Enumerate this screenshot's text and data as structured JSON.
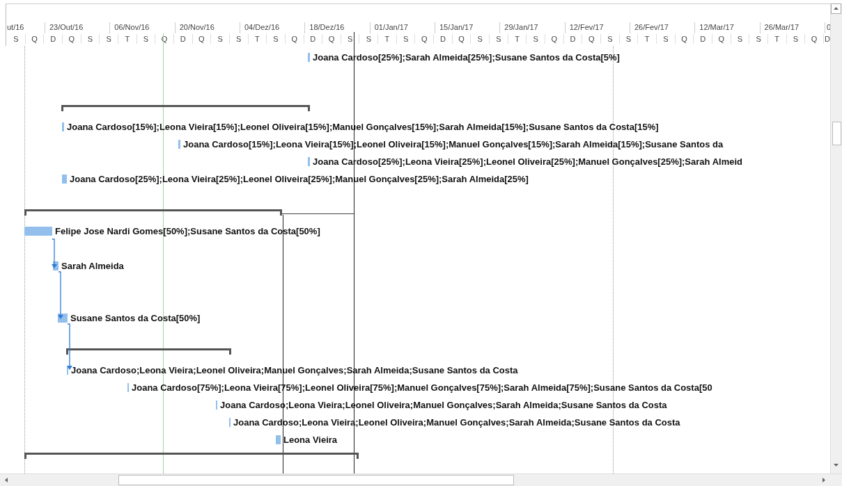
{
  "timescale": {
    "major": [
      "ut/16",
      "23/Out/16",
      "06/Nov/16",
      "20/Nov/16",
      "04/Dez/16",
      "18/Dez/16",
      "01/Jan/17",
      "15/Jan/17",
      "29/Jan/17",
      "12/Fev/17",
      "26/Fev/17",
      "12/Mar/17",
      "26/Mar/17",
      "0"
    ],
    "minor": [
      "S",
      "Q",
      "D",
      "Q",
      "S",
      "S",
      "T",
      "S",
      "Q",
      "D",
      "Q",
      "S",
      "S",
      "T",
      "S",
      "Q",
      "D",
      "Q",
      "S",
      "S",
      "T",
      "S",
      "Q",
      "D",
      "Q",
      "S",
      "S",
      "T",
      "S",
      "Q",
      "D",
      "Q",
      "S",
      "S",
      "T",
      "S",
      "Q",
      "D",
      "Q",
      "S",
      "S",
      "T",
      "S",
      "Q",
      "D"
    ]
  },
  "rows": [
    {
      "kind": "task",
      "label": "Joana Cardoso[25%];Sarah Almeida[25%];Susane Santos da Costa[5%]"
    },
    {
      "kind": "summary"
    },
    {
      "kind": "task",
      "label": "Joana Cardoso[15%];Leona Vieira[15%];Leonel Oliveira[15%];Manuel Gonçalves[15%];Sarah Almeida[15%];Susane Santos da Costa[15%]"
    },
    {
      "kind": "task",
      "label": "Joana Cardoso[15%];Leona Vieira[15%];Leonel Oliveira[15%];Manuel Gonçalves[15%];Sarah Almeida[15%];Susane Santos da"
    },
    {
      "kind": "task",
      "label": "Joana Cardoso[25%];Leona Vieira[25%];Leonel Oliveira[25%];Manuel Gonçalves[25%];Sarah Almeid"
    },
    {
      "kind": "task",
      "label": "Joana Cardoso[25%];Leona Vieira[25%];Leonel Oliveira[25%];Manuel Gonçalves[25%];Sarah Almeida[25%]"
    },
    {
      "kind": "summary"
    },
    {
      "kind": "task",
      "label": "Felipe Jose Nardi Gomes[50%];Susane Santos da Costa[50%]"
    },
    {
      "kind": "task",
      "label": "Sarah Almeida"
    },
    {
      "kind": "task",
      "label": "Susane Santos da Costa[50%]"
    },
    {
      "kind": "summary"
    },
    {
      "kind": "task",
      "label": "Joana Cardoso;Leona Vieira;Leonel Oliveira;Manuel Gonçalves;Sarah Almeida;Susane Santos da Costa"
    },
    {
      "kind": "task",
      "label": "Joana Cardoso[75%];Leona Vieira[75%];Leonel Oliveira[75%];Manuel Gonçalves[75%];Sarah Almeida[75%];Susane Santos da Costa[50"
    },
    {
      "kind": "task",
      "label": "Joana Cardoso;Leona Vieira;Leonel Oliveira;Manuel Gonçalves;Sarah Almeida;Susane Santos da Costa"
    },
    {
      "kind": "task",
      "label": "Joana Cardoso;Leona Vieira;Leonel Oliveira;Manuel Gonçalves;Sarah Almeida;Susane Santos da Costa"
    },
    {
      "kind": "task",
      "label": "Leona Vieira"
    },
    {
      "kind": "summary"
    }
  ]
}
